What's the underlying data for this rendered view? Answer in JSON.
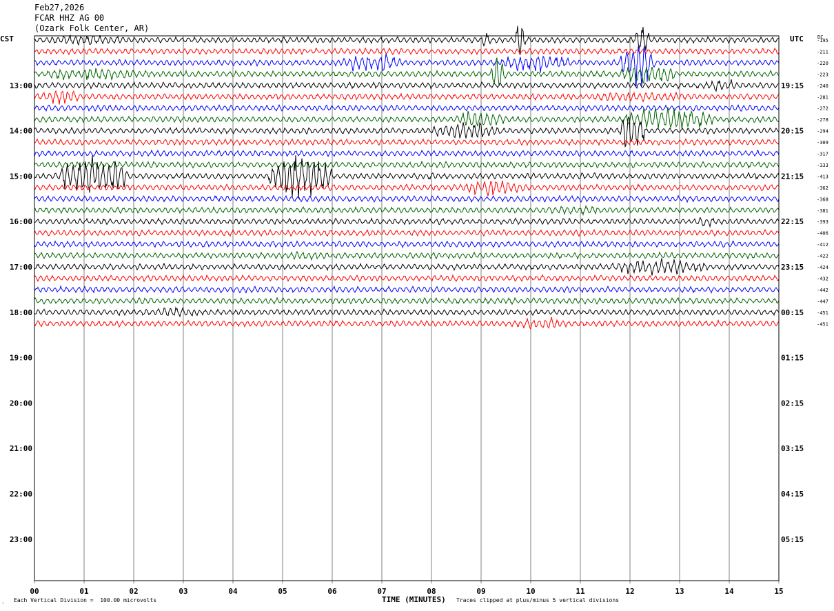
{
  "header": {
    "date": "Feb27,2026",
    "station": "FCAR HHZ AG 00",
    "location": "(Ozark Folk Center, AR)"
  },
  "left_tz": "CST",
  "right_tz": "UTC",
  "dc_label": "DC",
  "footer": {
    "scale": "Each Vertical Division =  100.00 microvolts",
    "xlabel": "TIME (MINUTES)",
    "clip_note": "Traces clipped at plus/minus 5 vertical divisions",
    "corner_mark": "."
  },
  "colors": {
    "trace_cycle": [
      "#000000",
      "#ff0000",
      "#0000ff",
      "#006400"
    ],
    "grid": "#808080",
    "frame": "#000000"
  },
  "chart_data": {
    "type": "helicorder",
    "xlabel": "TIME (MINUTES)",
    "xlim": [
      0,
      15
    ],
    "x_ticks": [
      "00",
      "01",
      "02",
      "03",
      "04",
      "05",
      "06",
      "07",
      "08",
      "09",
      "10",
      "11",
      "12",
      "13",
      "14",
      "15"
    ],
    "left_hour_labels": [
      "13:00",
      "14:00",
      "15:00",
      "16:00",
      "17:00",
      "18:00",
      "19:00",
      "20:00",
      "21:00",
      "22:00",
      "23:00"
    ],
    "right_hour_labels": [
      "19:15",
      "20:15",
      "21:15",
      "22:15",
      "23:15",
      "00:15",
      "01:15",
      "02:15",
      "03:15",
      "04:15",
      "05:15"
    ],
    "dc_offsets": [
      "-195",
      "-211",
      "-220",
      "-223",
      "-240",
      "-281",
      "-272",
      "-278",
      "-294",
      "-309",
      "-317",
      "-333",
      "-413",
      "-362",
      "-368",
      "-381",
      "-393",
      "-406",
      "-412",
      "-422",
      "-424",
      "-432",
      "-442",
      "-447",
      "-451",
      "-451"
    ],
    "trace_count": 26,
    "lines_per_hour": 4,
    "events": [
      {
        "trace": 0,
        "start_min": 0.0,
        "end_min": 2.0,
        "amp": 7
      },
      {
        "trace": 0,
        "start_min": 9.0,
        "end_min": 9.2,
        "amp": 10
      },
      {
        "trace": 0,
        "start_min": 9.7,
        "end_min": 9.9,
        "amp": 30
      },
      {
        "trace": 0,
        "start_min": 12.1,
        "end_min": 12.4,
        "amp": 25
      },
      {
        "trace": 2,
        "start_min": 6.2,
        "end_min": 7.4,
        "amp": 14
      },
      {
        "trace": 2,
        "start_min": 9.4,
        "end_min": 10.8,
        "amp": 14
      },
      {
        "trace": 2,
        "start_min": 11.8,
        "end_min": 12.5,
        "amp": 30
      },
      {
        "trace": 3,
        "start_min": 0.0,
        "end_min": 2.4,
        "amp": 9
      },
      {
        "trace": 3,
        "start_min": 9.2,
        "end_min": 9.5,
        "amp": 28
      },
      {
        "trace": 3,
        "start_min": 11.8,
        "end_min": 13.0,
        "amp": 14
      },
      {
        "trace": 4,
        "start_min": 13.5,
        "end_min": 14.2,
        "amp": 9
      },
      {
        "trace": 5,
        "start_min": 0.0,
        "end_min": 1.0,
        "amp": 10
      },
      {
        "trace": 5,
        "start_min": 11.0,
        "end_min": 13.5,
        "amp": 7
      },
      {
        "trace": 7,
        "start_min": 8.5,
        "end_min": 9.5,
        "amp": 14
      },
      {
        "trace": 7,
        "start_min": 11.8,
        "end_min": 13.7,
        "amp": 16
      },
      {
        "trace": 8,
        "start_min": 8.0,
        "end_min": 9.4,
        "amp": 13
      },
      {
        "trace": 8,
        "start_min": 11.8,
        "end_min": 12.3,
        "amp": 28
      },
      {
        "trace": 12,
        "start_min": 0.5,
        "end_min": 1.9,
        "amp": 30
      },
      {
        "trace": 12,
        "start_min": 4.7,
        "end_min": 6.0,
        "amp": 30
      },
      {
        "trace": 13,
        "start_min": 8.6,
        "end_min": 10.0,
        "amp": 12
      },
      {
        "trace": 15,
        "start_min": 9.8,
        "end_min": 12.0,
        "amp": 6
      },
      {
        "trace": 16,
        "start_min": 13.2,
        "end_min": 13.8,
        "amp": 7
      },
      {
        "trace": 19,
        "start_min": 5.0,
        "end_min": 6.0,
        "amp": 6
      },
      {
        "trace": 20,
        "start_min": 11.5,
        "end_min": 13.6,
        "amp": 11
      },
      {
        "trace": 24,
        "start_min": 2.3,
        "end_min": 3.4,
        "amp": 7
      },
      {
        "trace": 25,
        "start_min": 9.6,
        "end_min": 10.9,
        "amp": 8
      }
    ]
  }
}
